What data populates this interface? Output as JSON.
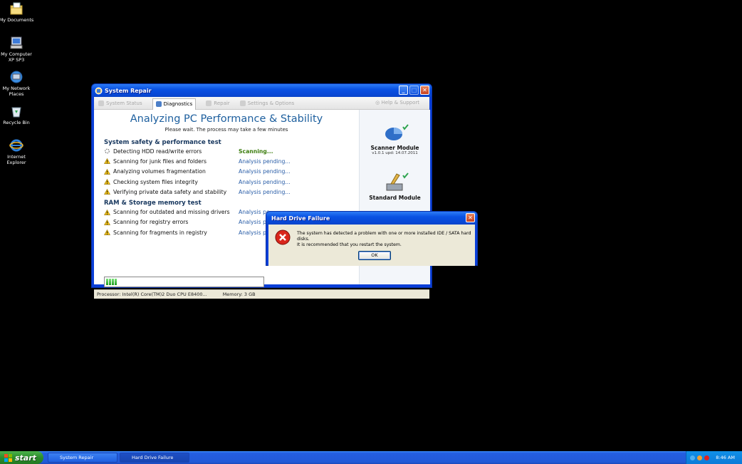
{
  "desktop": {
    "icons": [
      {
        "label": "My Documents",
        "icon": "folder-documents-icon"
      },
      {
        "label": "My Computer XP SP3",
        "icon": "computer-icon"
      },
      {
        "label": "My Network Places",
        "icon": "network-icon"
      },
      {
        "label": "Recycle Bin",
        "icon": "recycle-bin-icon"
      },
      {
        "label": "Internet Explorer",
        "icon": "internet-explorer-icon"
      }
    ]
  },
  "system_repair": {
    "title": "System Repair",
    "tabs": [
      "System Status",
      "Diagnostics",
      "Repair",
      "Settings & Options"
    ],
    "active_tab": "Diagnostics",
    "help_label": "Help & Support",
    "heading": "Analyzing PC Performance & Stability",
    "subheading": "Please wait. The process may take a few minutes",
    "section1": {
      "title": "System safety & performance test",
      "tasks": [
        {
          "name": "Detecting HDD read/write errors",
          "status": "Scanning..."
        },
        {
          "name": "Scanning for junk files and folders",
          "status": "Analysis pending..."
        },
        {
          "name": "Analyzing volumes fragmentation",
          "status": "Analysis pending..."
        },
        {
          "name": "Checking system files integrity",
          "status": "Analysis pending..."
        },
        {
          "name": "Verifying private data safety and stability",
          "status": "Analysis pending..."
        }
      ]
    },
    "section2": {
      "title": "RAM & Storage memory test",
      "tasks": [
        {
          "name": "Scanning for outdated and missing drivers",
          "status": "Analysis pe"
        },
        {
          "name": "Scanning for registry errors",
          "status": "Analysis pe"
        },
        {
          "name": "Scanning for fragments in registry",
          "status": "Analysis pe"
        }
      ]
    },
    "progress": {
      "percent": 7,
      "label": "7% completed"
    },
    "modules": [
      {
        "name": "Scanner Module",
        "version": "v1.0.1 upd: 14.07.2011"
      },
      {
        "name": "Standard Module",
        "version": ""
      }
    ],
    "status_bar": {
      "processor": "Processor: Intel(R) Core(TM)2 Duo CPU E8400...",
      "memory": "Memory: 3 GB"
    },
    "colors": {
      "heading": "#1d5f9e",
      "scanning": "#3c7d0e",
      "pending": "#2a5ea8"
    }
  },
  "dialog": {
    "title": "Hard Drive Failure",
    "line1": "The system has detected a problem with one or more installed IDE / SATA hard disks.",
    "line2": "It is recommended that you restart the system.",
    "ok_label": "OK"
  },
  "taskbar": {
    "start_label": "start",
    "tasks": [
      "System Repair",
      "Hard Drive Failure"
    ],
    "clock": "8:46 AM"
  }
}
